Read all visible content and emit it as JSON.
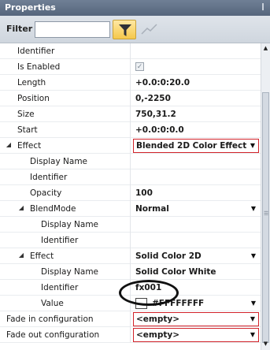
{
  "window": {
    "title": "Properties",
    "pin_icon": "pin-icon"
  },
  "filter": {
    "label": "Filter",
    "value": "",
    "placeholder": ""
  },
  "properties": {
    "identifier_label": "Identifier",
    "is_enabled_label": "Is Enabled",
    "length_label": "Length",
    "length_value": "+0.0:0:20.0",
    "position_label": "Position",
    "position_value": "0,-2250",
    "size_label": "Size",
    "size_value": "750,31.2",
    "start_label": "Start",
    "start_value": "+0.0:0:0.0",
    "effect_label": "Effect",
    "effect_value": "Blended 2D Color Effect",
    "effect_display_name_label": "Display Name",
    "effect_identifier_label": "Identifier",
    "opacity_label": "Opacity",
    "opacity_value": "100",
    "blendmode_label": "BlendMode",
    "blendmode_value": "Normal",
    "blend_display_name_label": "Display Name",
    "blend_identifier_label": "Identifier",
    "inner_effect_label": "Effect",
    "inner_effect_value": "Solid Color 2D",
    "inner_display_name_label": "Display Name",
    "inner_display_name_value": "Solid Color White",
    "inner_identifier_label": "Identifier",
    "inner_identifier_value": "fx001",
    "value_label": "Value",
    "value_color": "#FFFFFFFF",
    "fade_in_label": "Fade in configuration",
    "fade_in_value": "<empty>",
    "fade_out_label": "Fade out configuration",
    "fade_out_value": "<empty>"
  },
  "colors": {
    "highlight_border": "#d2232a",
    "title_bar": "#5f6f85"
  }
}
